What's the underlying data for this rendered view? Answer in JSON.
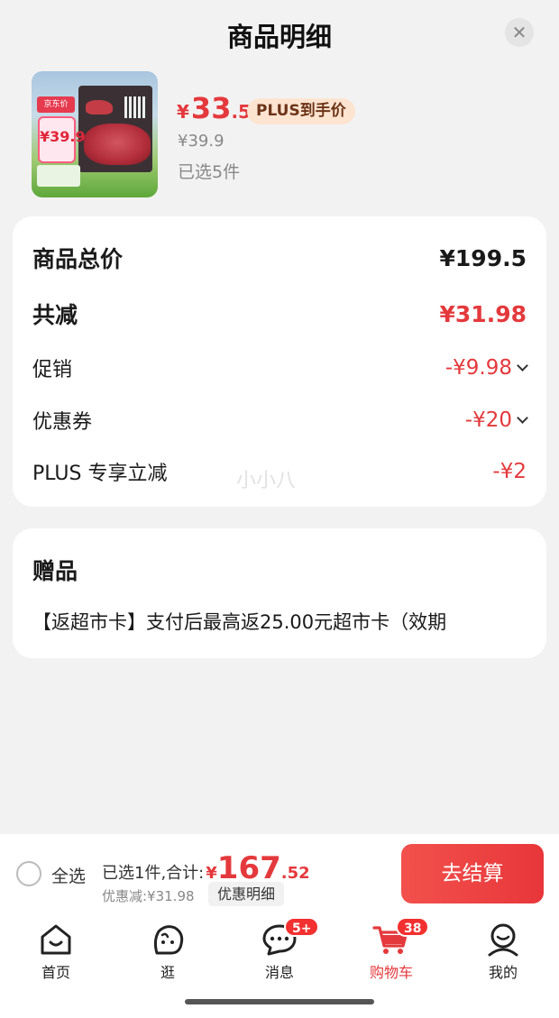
{
  "sheet": {
    "title": "商品明细",
    "close_glyph": "✕"
  },
  "product": {
    "image_tag": "京东价",
    "image_price": "¥39.9",
    "price_yen": "¥",
    "price_int": "33",
    "price_dec": ".5",
    "plus_tag": "PLUS到手价",
    "original_price": "¥39.9",
    "selected": "已选5件"
  },
  "summary": {
    "total_label": "商品总价",
    "total_value": "¥199.5",
    "reduce_label": "共减",
    "reduce_value": "¥31.98",
    "promo_label": "促销",
    "promo_value": "-¥9.98",
    "coupon_label": "优惠券",
    "coupon_value": "-¥20",
    "plus_label": "PLUS 专享立减",
    "plus_value": "-¥2",
    "watermark": "小小八"
  },
  "gift": {
    "title": "赠品",
    "text": "【返超市卡】支付后最高返25.00元超市卡（效期"
  },
  "checkout": {
    "select_all": "全选",
    "sum_label": "已选1件,合计:",
    "sum_yen": "¥",
    "sum_int": "167",
    "sum_dec": ".52",
    "discount": "优惠减:¥31.98",
    "detail_button": "优惠明细",
    "checkout_button": "去结算"
  },
  "tabs": [
    {
      "label": "首页",
      "icon": "home-icon"
    },
    {
      "label": "逛",
      "icon": "explore-icon"
    },
    {
      "label": "消息",
      "icon": "message-icon",
      "badge": "5+"
    },
    {
      "label": "购物车",
      "icon": "cart-icon",
      "badge": "38",
      "active": true
    },
    {
      "label": "我的",
      "icon": "profile-icon"
    }
  ],
  "colors": {
    "accent": "#e4393c",
    "plus_bg": "#fde4d0"
  }
}
